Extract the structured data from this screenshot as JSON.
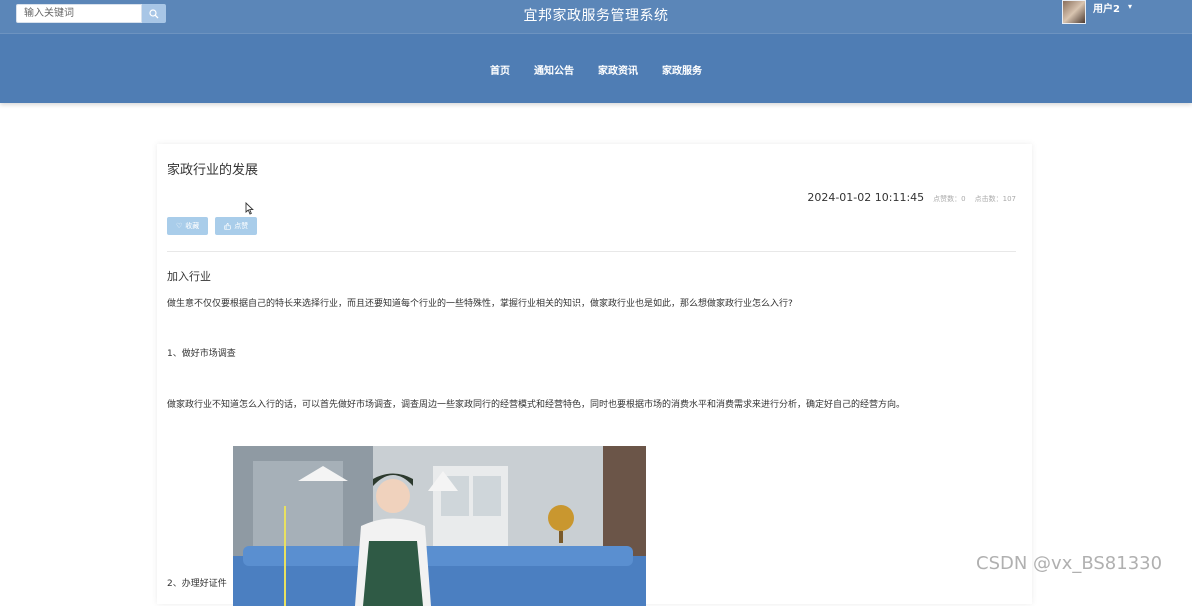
{
  "header": {
    "search_placeholder": "输入关键词",
    "site_title": "宜邦家政服务管理系统",
    "user_name": "用户2"
  },
  "nav": [
    {
      "label": "首页"
    },
    {
      "label": "通知公告"
    },
    {
      "label": "家政资讯"
    },
    {
      "label": "家政服务"
    }
  ],
  "article": {
    "title": "家政行业的发展",
    "date": "2024-01-02 10:11:45",
    "likes_label": "点赞数：0",
    "clicks_label": "点击数：107",
    "favorite_label": "收藏",
    "like_label": "点赞",
    "section_heading": "加入行业",
    "paragraphs": [
      "做生意不仅仅要根据自己的特长来选择行业，而且还要知道每个行业的一些特殊性，掌握行业相关的知识，做家政行业也是如此，那么想做家政行业怎么入行?",
      "1、做好市场调查",
      "做家政行业不知道怎么入行的话，可以首先做好市场调查，调查周边一些家政同行的经营模式和经营特色，同时也要根据市场的消费水平和消费需求来进行分析，确定好自己的经营方向。",
      "2、办理好证件"
    ]
  },
  "watermark": "CSDN @vx_BS81330",
  "icons": {
    "search": "search-icon",
    "caret": "caret-down-icon",
    "favorite": "heart-icon",
    "like": "thumbs-up-icon"
  },
  "colors": {
    "header_bg": "#4f7db4",
    "button_bg": "#a9cdea"
  }
}
